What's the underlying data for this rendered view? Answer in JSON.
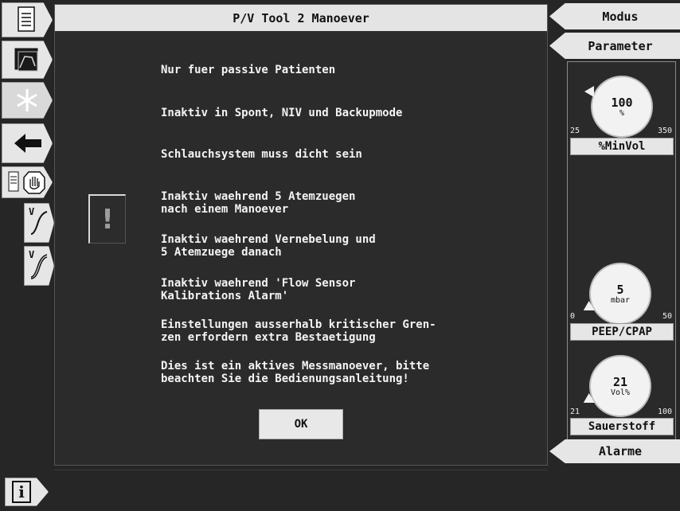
{
  "dialog": {
    "title": "P/V Tool 2 Manoever",
    "messages": [
      "Nur fuer passive Patienten",
      "Inaktiv in Spont, NIV und Backupmode",
      "Schlauchsystem muss dicht sein",
      "Inaktiv waehrend 5 Atemzuegen\nnach einem Manoever",
      "Inaktiv waehrend Vernebelung und\n5 Atemzuege danach",
      "Inaktiv waehrend 'Flow Sensor\nKalibrations Alarm'",
      "Einstellungen ausserhalb kritischer Gren-\nzen erfordern extra Bestaetigung",
      "Dies ist ein aktives Messmanoever, bitte\nbeachten Sie die Bedienungsanleitung!"
    ],
    "warning_symbol": "!",
    "ok_label": "OK"
  },
  "right_tabs": {
    "modus": "Modus",
    "parameter": "Parameter",
    "alarme": "Alarme"
  },
  "knobs": [
    {
      "value": "100",
      "unit": "%",
      "min": "25",
      "max": "350",
      "label": "%MinVol"
    },
    {
      "value": "5",
      "unit": "mbar",
      "min": "0",
      "max": "50",
      "label": "PEEP/CPAP"
    },
    {
      "value": "21",
      "unit": "Vol%",
      "min": "21",
      "max": "100",
      "label": "Sauerstoff"
    }
  ],
  "left_tabs": {
    "waveform_v1": "V",
    "waveform_v2": "V"
  },
  "info": {
    "label": "i"
  },
  "icons": [
    "document-icon",
    "trend-icon",
    "freeze-icon",
    "back-arrow-icon",
    "hold-hand-icon",
    "waveform-icon",
    "loop-icon",
    "info-icon"
  ]
}
